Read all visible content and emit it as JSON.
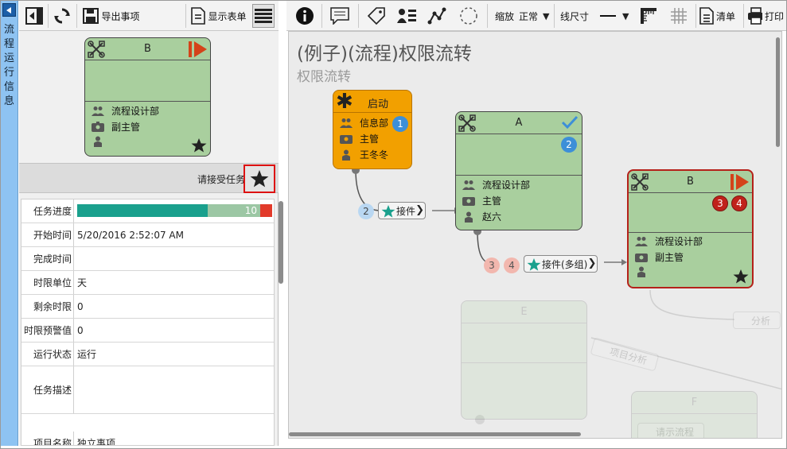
{
  "sidebar_tab": {
    "label": "流程运行信息"
  },
  "left_toolbar": {
    "export_label": "导出事项",
    "show_form_label": "显示表单"
  },
  "preview_node": {
    "title": "B",
    "department": "流程设计部",
    "role": "副主管"
  },
  "accept": {
    "label": "请接受任务"
  },
  "properties": {
    "progress": {
      "label": "任务进度",
      "value": "10",
      "fraction": 0.67
    },
    "start_time": {
      "label": "开始时间",
      "value": "5/20/2016 2:52:07 AM"
    },
    "finish_time": {
      "label": "完成时间",
      "value": ""
    },
    "time_unit": {
      "label": "时限单位",
      "value": "天"
    },
    "remaining": {
      "label": "剩余时限",
      "value": "0"
    },
    "warning": {
      "label": "时限预警值",
      "value": "0"
    },
    "state": {
      "label": "运行状态",
      "value": "运行"
    },
    "description": {
      "label": "任务描述",
      "value": ""
    },
    "item_name": {
      "label": "项目名称",
      "value": "独立事项"
    }
  },
  "right_toolbar": {
    "zoom_label": "缩放",
    "zoom_value": "正常",
    "line_size_label": "线尺寸",
    "list_label": "清单",
    "print_label": "打印"
  },
  "canvas": {
    "title": "(例子)(流程)权限流转",
    "subtitle": "权限流转",
    "start_node": {
      "title": "启动",
      "department": "信息部",
      "role": "主管",
      "person": "王冬冬",
      "badge": "1"
    },
    "node_a": {
      "title": "A",
      "badge": "2",
      "department": "流程设计部",
      "role": "主管",
      "person": "赵六"
    },
    "node_b": {
      "title": "B",
      "badges": [
        "3",
        "4"
      ],
      "department": "流程设计部",
      "role": "副主管"
    },
    "link1": {
      "badge": "2",
      "label": "接件"
    },
    "link2": {
      "badges": [
        "3",
        "4"
      ],
      "label": "接件(多组)"
    },
    "ghost_node_e": {
      "title": "E"
    },
    "ghost_node_f": {
      "title": "F"
    },
    "ghost_link_1": {
      "label": "分析"
    },
    "ghost_link_2": {
      "label": "项目分析"
    },
    "ghost_link_3": {
      "label": "请示流程"
    }
  },
  "colors": {
    "node_green": "#a9cf9e",
    "start_orange": "#f2a000",
    "progress_teal": "#1aa08d",
    "badge_blue": "#3d8fd8",
    "badge_red": "#c0221b",
    "highlight_red": "#d11111"
  }
}
